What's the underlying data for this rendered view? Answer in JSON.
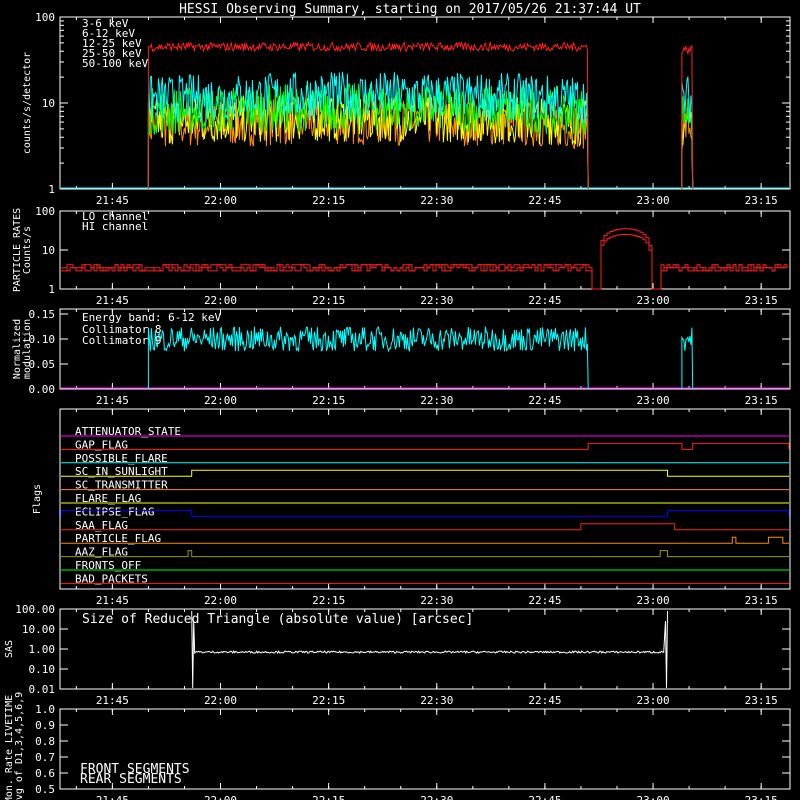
{
  "title": "HESSI Observing Summary, starting on 2017/05/26 21:37:44 UT",
  "time_ticks": [
    "21:45",
    "22:00",
    "22:15",
    "22:30",
    "22:45",
    "23:00",
    "23:15"
  ],
  "colors": {
    "background": "#000000",
    "axes": "#ffffff",
    "red": "#ff2020",
    "orange": "#ff8c00",
    "yellow": "#ffff00",
    "green": "#00ff00",
    "cyan": "#00ffff",
    "magenta": "#ff00ff",
    "blue": "#0000ff",
    "olive": "#9a9a00",
    "darkred": "#cc0000",
    "darkgreen": "#00aa00"
  },
  "chart_data": [
    {
      "type": "line",
      "panel": "count-rates",
      "ylabel": "counts/s/detector",
      "yscale": "log",
      "ylim": [
        1,
        100
      ],
      "y_ticks": [
        "1",
        "10",
        "100"
      ],
      "xlim": [
        "21:37:44",
        "23:19"
      ],
      "series": [
        {
          "name": "3-6 keV",
          "color": "#ff2020",
          "segments": [
            {
              "start": "21:50",
              "end": "22:51",
              "level": 45
            },
            {
              "start": "23:04",
              "end": "23:05:30",
              "level": 42
            }
          ]
        },
        {
          "name": "6-12 keV",
          "color": "#ff8c00",
          "segments": [
            {
              "start": "21:50",
              "end": "22:51",
              "level": 5.5
            },
            {
              "start": "23:04",
              "end": "23:05:30",
              "level": 5
            }
          ]
        },
        {
          "name": "12-25 keV",
          "color": "#ffff00",
          "segments": [
            {
              "start": "21:50",
              "end": "22:51",
              "level": 6
            },
            {
              "start": "23:04",
              "end": "23:05:30",
              "level": 5.5
            }
          ]
        },
        {
          "name": "25-50 keV",
          "color": "#00ff00",
          "segments": [
            {
              "start": "21:50",
              "end": "22:51",
              "level": 8
            },
            {
              "start": "23:04",
              "end": "23:05:30",
              "level": 7
            }
          ]
        },
        {
          "name": "50-100 keV",
          "color": "#00ffff",
          "segments": [
            {
              "start": "21:50",
              "end": "22:51",
              "level": 11
            },
            {
              "start": "23:04",
              "end": "23:05:30",
              "level": 10
            }
          ]
        }
      ]
    },
    {
      "type": "line",
      "panel": "particle-rates",
      "ylabel": "PARTICLE RATES Counts/s",
      "yscale": "log",
      "ylim": [
        1,
        100
      ],
      "y_ticks": [
        "1",
        "10",
        "100"
      ],
      "series": [
        {
          "name": "LO channel",
          "color": "#ff2020",
          "baseline": 3.5,
          "peak_time": "22:56",
          "peak": 35
        },
        {
          "name": "HI channel",
          "color": "#ff2020",
          "baseline": 3.5,
          "peak_time": "22:56",
          "peak": 25
        }
      ]
    },
    {
      "type": "line",
      "panel": "modulation",
      "ylabel": "Normalized modulation",
      "ylim": [
        0,
        0.15
      ],
      "y_ticks": [
        "0.00",
        "0.05",
        "0.10",
        "0.15"
      ],
      "annotation": "Energy band: 6-12 keV",
      "series": [
        {
          "name": "Collimator 8",
          "color": "#00ffff",
          "level": 0.1,
          "segments": [
            [
              "21:50",
              "22:51"
            ],
            [
              "23:04",
              "23:05:30"
            ]
          ]
        },
        {
          "name": "Collimator 9",
          "color": "#ff00ff",
          "level": 0.0
        }
      ]
    },
    {
      "type": "line",
      "panel": "flags",
      "ylabel": "Flags",
      "flags": [
        {
          "name": "ATTENUATOR_STATE",
          "color": "#ff00ff",
          "on": []
        },
        {
          "name": "GAP_FLAG",
          "color": "#ff2020",
          "on": [
            [
              "22:51",
              "23:04"
            ],
            [
              "23:05:30",
              "23:19"
            ]
          ]
        },
        {
          "name": "POSSIBLE_FLARE",
          "color": "#00ffff",
          "on": []
        },
        {
          "name": "SC_IN_SUNLIGHT",
          "color": "#ffff00",
          "on": [
            [
              "21:56",
              "23:02"
            ]
          ]
        },
        {
          "name": "SC_TRANSMITTER",
          "color": "#ff8c00",
          "on": []
        },
        {
          "name": "FLARE_FLAG",
          "color": "#ffff00",
          "on": []
        },
        {
          "name": "ECLIPSE_FLAG",
          "color": "#0000ff",
          "on": [
            [
              "21:37:44",
              "21:56"
            ],
            [
              "23:02",
              "23:19"
            ]
          ]
        },
        {
          "name": "SAA_FLAG",
          "color": "#ff2020",
          "on": [
            [
              "22:50",
              "23:03"
            ]
          ]
        },
        {
          "name": "PARTICLE_FLAG",
          "color": "#ff8c00",
          "on": [
            [
              "23:11",
              "23:11:30"
            ],
            [
              "23:16",
              "23:18"
            ]
          ]
        },
        {
          "name": "AAZ_FLAG",
          "color": "#9a9a00",
          "on": [
            [
              "21:55:30",
              "21:56"
            ],
            [
              "23:01",
              "23:02"
            ]
          ]
        },
        {
          "name": "FRONTS_OFF",
          "color": "#00ff00",
          "on": []
        },
        {
          "name": "BAD_PACKETS",
          "color": "#ff2020",
          "on": []
        }
      ]
    },
    {
      "type": "line",
      "panel": "sas",
      "ylabel": "SAS",
      "yscale": "log",
      "ylim": [
        0.01,
        100
      ],
      "y_ticks": [
        "100.00",
        "10.00",
        "1.00",
        "0.10",
        "0.01"
      ],
      "annotation": "Size of Reduced Triangle (absolute value) [arcsec]",
      "series": [
        {
          "name": "",
          "color": "#ffffff",
          "level": 0.7,
          "segments": [
            [
              "21:56",
              "23:02"
            ]
          ]
        }
      ]
    },
    {
      "type": "line",
      "panel": "livetime",
      "ylabel": "Mon. Rate LIVETIME avg of D1,3,4,5,6,9",
      "ylim": [
        0.5,
        1.0
      ],
      "y_ticks": [
        "0.5",
        "0.6",
        "0.7",
        "0.8",
        "0.9",
        "1.0"
      ],
      "series": [
        {
          "name": "FRONT SEGMENTS",
          "color": "#00ff00",
          "values": []
        },
        {
          "name": "REAR SEGMENTS",
          "color": "#00aa00",
          "values": []
        }
      ]
    }
  ]
}
